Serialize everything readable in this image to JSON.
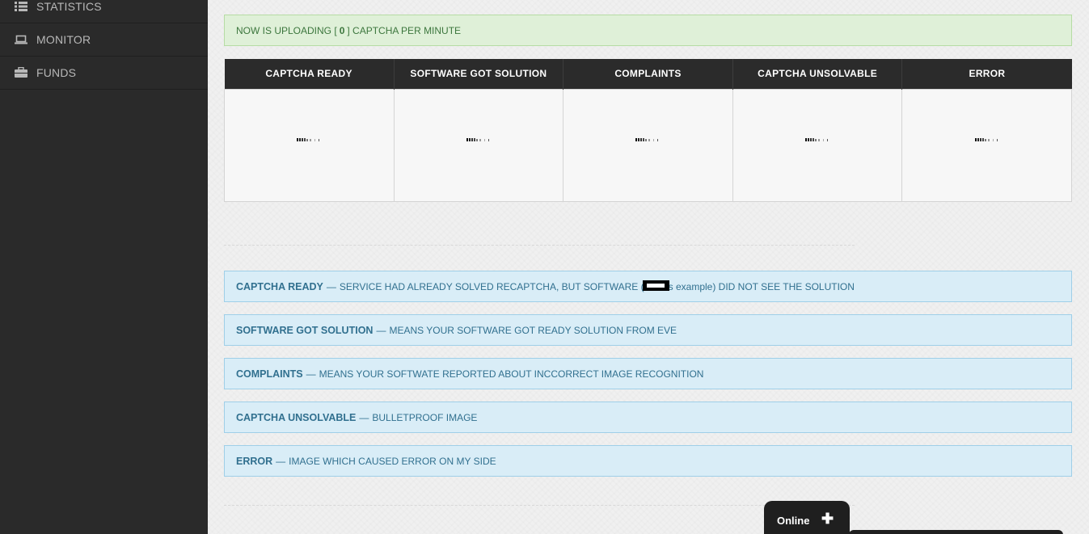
{
  "sidebar": {
    "items": [
      {
        "label": "STATISTICS",
        "icon": "list-icon"
      },
      {
        "label": "MONITOR",
        "icon": "laptop-icon"
      },
      {
        "label": "FUNDS",
        "icon": "briefcase-icon"
      }
    ]
  },
  "upload_alert": {
    "prefix": "NOW IS UPLOADING [",
    "count": "0",
    "suffix": "] CAPTCHA PER MINUTE"
  },
  "stats_table": {
    "columns": [
      "CAPTCHA READY",
      "SOFTWARE GOT SOLUTION",
      "COMPLAINTS",
      "CAPTCHA UNSOLVABLE",
      "ERROR"
    ]
  },
  "legend": [
    {
      "term": "CAPTCHA READY",
      "dash": "—",
      "text_before": "SERVICE HAD ALREADY SOLVED RECAPTCHA, BUT SOFTWARE (",
      "text_after": "s example) DID NOT SEE THE SOLUTION"
    },
    {
      "term": "SOFTWARE GOT SOLUTION",
      "dash": "—",
      "text": "MEANS YOUR SOFTWARE GOT READY SOLUTION FROM EVE"
    },
    {
      "term": "COMPLAINTS",
      "dash": "—",
      "text": "MEANS YOUR SOFTWATE REPORTED ABOUT INCCORRECT IMAGE RECOGNITION"
    },
    {
      "term": "CAPTCHA UNSOLVABLE",
      "dash": "—",
      "text": "BULLETPROOF IMAGE"
    },
    {
      "term": "ERROR",
      "dash": "—",
      "text": "IMAGE WHICH CAUSED ERROR ON MY SIDE"
    }
  ],
  "chat": {
    "label": "Online",
    "toggle": "✚"
  },
  "colors": {
    "sidebar_bg": "#2a2a2a",
    "success_bg": "#dff0d8",
    "success_text": "#3c763d",
    "info_bg": "#d9edf7",
    "info_text": "#31708f",
    "table_header_bg": "#2b2b2b"
  }
}
